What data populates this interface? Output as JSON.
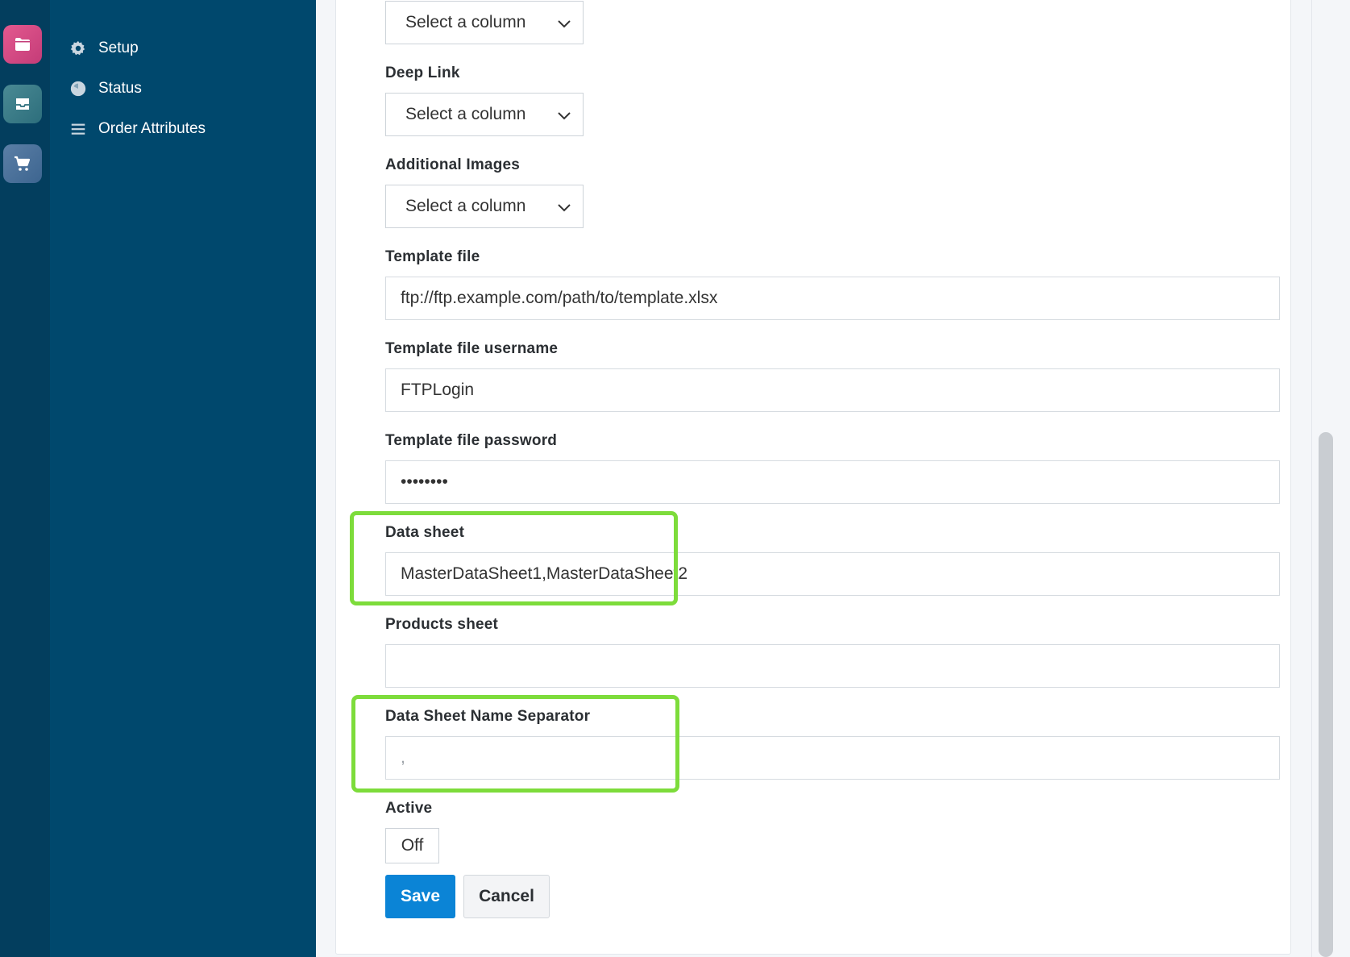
{
  "nav": {
    "items": [
      {
        "label": "Setup",
        "icon": "gear-icon"
      },
      {
        "label": "Status",
        "icon": "status-icon"
      },
      {
        "label": "Order Attributes",
        "icon": "list-icon"
      }
    ]
  },
  "rail": {
    "items": [
      {
        "icon": "folder-icon",
        "color": "#d94784"
      },
      {
        "icon": "inbox-icon",
        "color": "#3b7d88"
      },
      {
        "icon": "cart-icon",
        "color": "#4c739c"
      }
    ]
  },
  "form": {
    "top_select": {
      "value": "Select a column"
    },
    "deep_link": {
      "label": "Deep Link",
      "value": "Select a column"
    },
    "additional_images": {
      "label": "Additional Images",
      "value": "Select a column"
    },
    "template_file": {
      "label": "Template file",
      "value": "ftp://ftp.example.com/path/to/template.xlsx"
    },
    "template_username": {
      "label": "Template file username",
      "value": "FTPLogin"
    },
    "template_password": {
      "label": "Template file password",
      "value": "••••••••"
    },
    "data_sheet": {
      "label": "Data sheet",
      "value": "MasterDataSheet1,MasterDataSheet2"
    },
    "products_sheet": {
      "label": "Products sheet",
      "value": ""
    },
    "separator": {
      "label": "Data Sheet Name Separator",
      "placeholder": ","
    },
    "active": {
      "label": "Active",
      "value": "Off"
    },
    "save_label": "Save",
    "cancel_label": "Cancel"
  },
  "colors": {
    "highlight": "#7ddc3b",
    "primary": "#0b84d6",
    "sidebar": "#00486d"
  }
}
